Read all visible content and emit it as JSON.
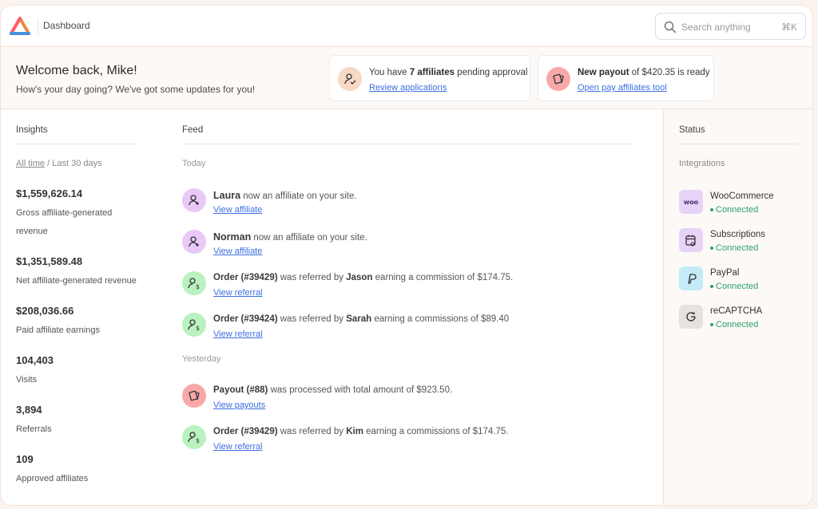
{
  "header": {
    "breadcrumb": "Dashboard",
    "search_placeholder": "Search anything",
    "search_shortcut": "⌘K"
  },
  "welcome": {
    "title": "Welcome back, Mike!",
    "subtitle": "How's your day going? We've got some updates for you!",
    "notices": [
      {
        "icon": "affiliate-pending-icon",
        "text_pre": "You have ",
        "text_bold": "7 affiliates",
        "text_post": " pending approval",
        "link": "Review applications",
        "icon_bg": "#f7d9c4"
      },
      {
        "icon": "payout-icon",
        "text_pre": "",
        "text_bold": "New payout",
        "text_post": " of $420.35 is ready",
        "link": "Open pay affiliates tool",
        "icon_bg": "#f9a8a8"
      }
    ]
  },
  "insights": {
    "title": "Insights",
    "range_active": "All time",
    "range_separator": " / ",
    "range_other": "Last 30 days",
    "metrics": [
      {
        "value": "$1,559,626.14",
        "label": "Gross affiliate-generated revenue"
      },
      {
        "value": "$1,351,589.48",
        "label": "Net affiliate-generated revenue"
      },
      {
        "value": "$208,036.66",
        "label": "Paid affiliate earnings"
      },
      {
        "value": "104,403",
        "label": "Visits"
      },
      {
        "value": "3,894",
        "label": "Referrals"
      },
      {
        "value": "109",
        "label": "Approved affiliates"
      }
    ]
  },
  "feed": {
    "title": "Feed",
    "today_label": "Today",
    "yesterday_label": "Yesterday",
    "today": [
      {
        "icon": "user-add-icon",
        "bg": "#e9c8f7",
        "s1": "Laura",
        "t1": " now an affiliate on your site.",
        "link": "View affiliate"
      },
      {
        "icon": "user-add-icon",
        "bg": "#e9c8f7",
        "s1": "Norman",
        "t1": " now an affiliate on your site.",
        "link": "View affiliate"
      },
      {
        "icon": "user-dollar-icon",
        "bg": "#b9f2c0",
        "s1": "Order (#39429)",
        "t1": " was referred by ",
        "s2": "Jason",
        "t2": " earning a commission of $174.75.",
        "link": "View referral"
      },
      {
        "icon": "user-dollar-icon",
        "bg": "#b9f2c0",
        "s1": "Order (#39424)",
        "t1": " was referred by ",
        "s2": "Sarah",
        "t2": " earning a commissions of $89.40",
        "link": "View referral"
      }
    ],
    "yesterday": [
      {
        "icon": "payout-icon",
        "bg": "#f9a8a8",
        "s1": "Payout (#88)",
        "t1": " was processed with total amount of $923.50.",
        "link": "View payouts"
      },
      {
        "icon": "user-dollar-icon",
        "bg": "#b9f2c0",
        "s1": "Order (#39429)",
        "t1": " was referred by ",
        "s2": "Kim",
        "t2": " earning a commissions of $174.75.",
        "link": "View referral"
      }
    ]
  },
  "status": {
    "title": "Status",
    "integrations_label": "Integrations",
    "integrations": [
      {
        "name": "WooCommerce",
        "state": "Connected",
        "icon": "woocommerce-icon",
        "bg": "#e7d3f7"
      },
      {
        "name": "Subscriptions",
        "state": "Connected",
        "icon": "subscriptions-icon",
        "bg": "#e7d3f7"
      },
      {
        "name": "PayPal",
        "state": "Connected",
        "icon": "paypal-icon",
        "bg": "#c4ecf7"
      },
      {
        "name": "reCAPTCHA",
        "state": "Connected",
        "icon": "recaptcha-icon",
        "bg": "#e8e2df"
      }
    ]
  },
  "colors": {
    "link": "#3c6fe0",
    "connected": "#2aa36b",
    "panel_bg": "#fdf9f6"
  }
}
